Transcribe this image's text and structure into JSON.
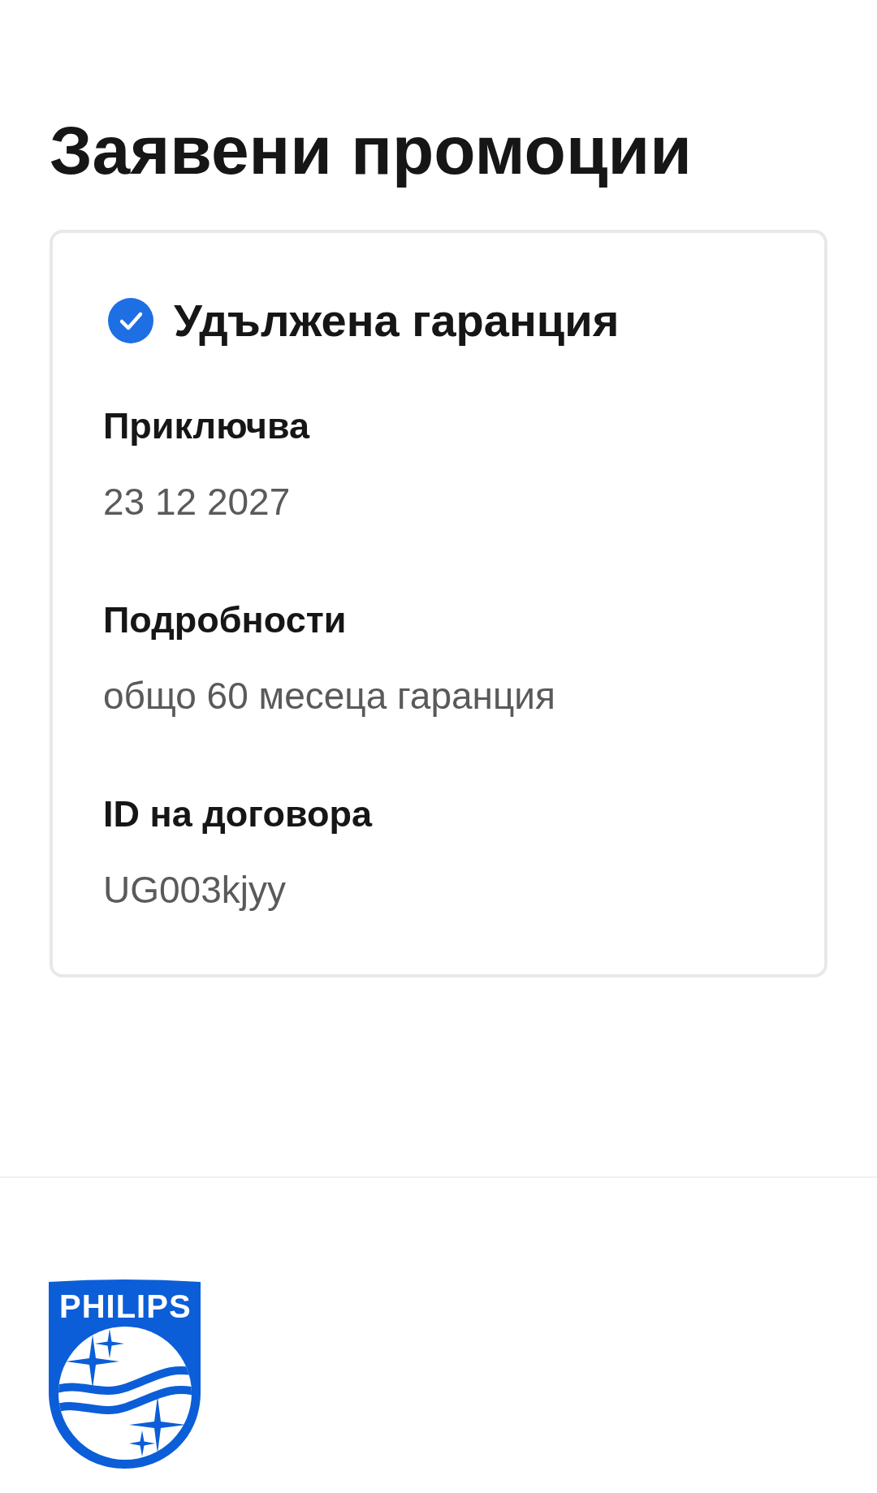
{
  "page": {
    "title": "Заявени промоции"
  },
  "promotions": [
    {
      "title": "Удължена гаранция",
      "verified": true,
      "fields": [
        {
          "label": "Приключва",
          "value": "23 12 2027"
        },
        {
          "label": "Подробности",
          "value": "общо 60 месеца гаранция"
        },
        {
          "label": "ID на договора",
          "value": "UG003kjyy"
        }
      ]
    }
  ],
  "footer": {
    "logo": {
      "wordmark": "PHILIPS"
    }
  }
}
